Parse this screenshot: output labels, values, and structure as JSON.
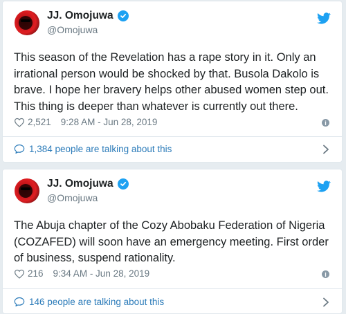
{
  "colors": {
    "page_bg": "#e6ecf0",
    "card_bg": "#ffffff",
    "twitter_blue": "#1da1f2",
    "link_blue": "#2b7bb9",
    "muted_gray": "#697882"
  },
  "tweets": [
    {
      "author": "JJ. Omojuwa",
      "handle": "@Omojuwa",
      "text": "This season of the Revelation has a rape story in it. Only an irrational person would be shocked by that. Busola Dakolo is brave. I hope her bravery helps other abused women step out. This thing is deeper than whatever is currently out there.",
      "likes": "2,521",
      "timestamp": "9:28 AM - Jun 28, 2019",
      "talking": "1,384 people are talking about this"
    },
    {
      "author": "JJ. Omojuwa",
      "handle": "@Omojuwa",
      "text": "The Abuja chapter of the Cozy Abobaku Federation of Nigeria (COZAFED) will soon have an emergency meeting. First order of business, suspend rationality.",
      "likes": "216",
      "timestamp": "9:34 AM - Jun 28, 2019",
      "talking": "146 people are talking about this"
    }
  ],
  "icons": [
    "verified-badge-icon",
    "twitter-bird-icon",
    "heart-icon",
    "info-icon",
    "speech-bubble-icon",
    "chevron-right-icon"
  ]
}
